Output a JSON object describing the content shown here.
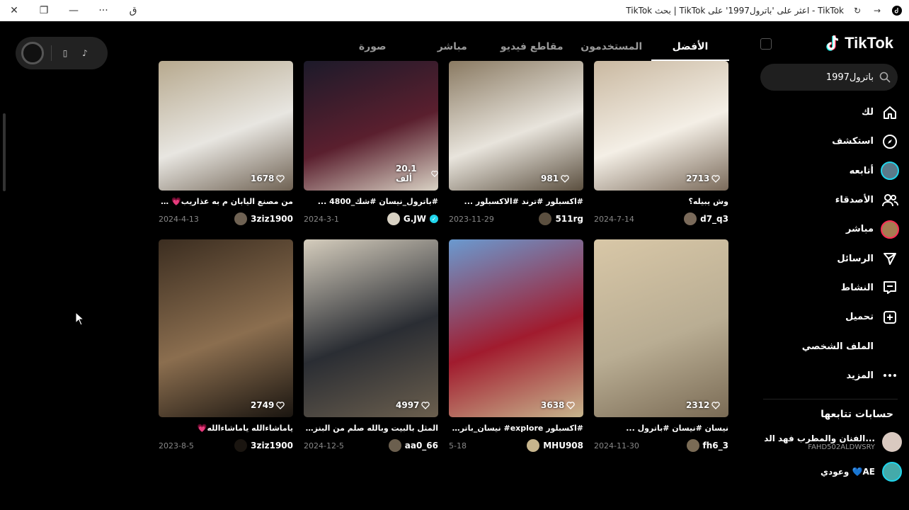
{
  "window": {
    "title": "TikTok بحث | TikTok اعثر على 'باترول1997' على - TikTok",
    "controls": [
      "close",
      "restore",
      "minimize",
      "more",
      "translate"
    ]
  },
  "sidebar": {
    "logo_text": "TikTok",
    "search_value": "باترول1997",
    "nav": [
      {
        "label": "لك",
        "icon": "home-icon"
      },
      {
        "label": "استكشف",
        "icon": "compass-icon"
      },
      {
        "label": "أتابعه",
        "icon": "following-avatar"
      },
      {
        "label": "الأصدقاء",
        "icon": "friends-icon"
      },
      {
        "label": "مباشر",
        "icon": "live-avatar"
      },
      {
        "label": "الرسائل",
        "icon": "send-icon"
      },
      {
        "label": "النشاط",
        "icon": "inbox-icon"
      },
      {
        "label": "تحميل",
        "icon": "upload-icon"
      },
      {
        "label": "الملف الشخصي",
        "icon": "profile-icon"
      },
      {
        "label": "المزيد",
        "icon": "more-icon"
      }
    ],
    "following_heading": "حسابات تتابعها",
    "following": [
      {
        "name": "الفنان والمطرب فهد الد...",
        "handle": "FAHD502ALDWSRY"
      },
      {
        "name": "وعودي 💙AE",
        "handle": ""
      }
    ]
  },
  "tabs": [
    "الأفضل",
    "المستخدمون",
    "مقاطع فيديو",
    "مباشر",
    "صورة"
  ],
  "videos": [
    {
      "likes": "2713",
      "caption": "وش يبيله؟",
      "author": "d7_q3",
      "date": "2024-7-14",
      "verified": false,
      "colors": [
        "#c9b8a0",
        "#f4efe6",
        "#7a6a5a"
      ]
    },
    {
      "likes": "981",
      "caption": "#اكسبلور #ترند #الاكسبلور ...",
      "author": "511rg",
      "date": "2023-11-29",
      "verified": false,
      "colors": [
        "#8a7a62",
        "#e8e4dc",
        "#5b4f3f"
      ]
    },
    {
      "likes": "20.1 ألف",
      "caption": "#باترول_نيسان #شك_4800 ...",
      "author": "G.JW",
      "date": "2024-3-1",
      "verified": true,
      "colors": [
        "#1c1a2a",
        "#5a1f2e",
        "#d9d2c4"
      ]
    },
    {
      "likes": "1678",
      "caption": "من مصنع اليابان م به عذاريب💗 💗 .",
      "author": "3ziz1900",
      "date": "2024-4-13",
      "verified": false,
      "colors": [
        "#b7a98e",
        "#e8e6e1",
        "#6f6253"
      ]
    },
    {
      "likes": "2312",
      "caption": "نيسان #نيسان #باترول ...",
      "author": "fh6_3",
      "date": "2024-11-30",
      "verified": false,
      "colors": [
        "#d8c7a7",
        "#b9ad93",
        "#7a6b55"
      ]
    },
    {
      "likes": "3638",
      "caption": "#اكسبلور explore# نيسان_باترول ...",
      "author": "MHU908",
      "date": "5-18",
      "verified": false,
      "colors": [
        "#6a9ad0",
        "#a11b2e",
        "#c7b58d"
      ]
    },
    {
      "likes": "4997",
      "caption": "المثل بالبيت وبالله صلم من البنزين 🤣",
      "author": "aa0_66",
      "date": "2024-12-5",
      "verified": false,
      "colors": [
        "#d5cdbd",
        "#2a2d33",
        "#6b5f4e"
      ]
    },
    {
      "likes": "2749",
      "caption": "ياماشاءالله ياماشاءالله💗",
      "author": "3ziz1900",
      "date": "2023-8-5",
      "verified": false,
      "colors": [
        "#3b2d20",
        "#8b6e4f",
        "#1a1510"
      ]
    }
  ]
}
